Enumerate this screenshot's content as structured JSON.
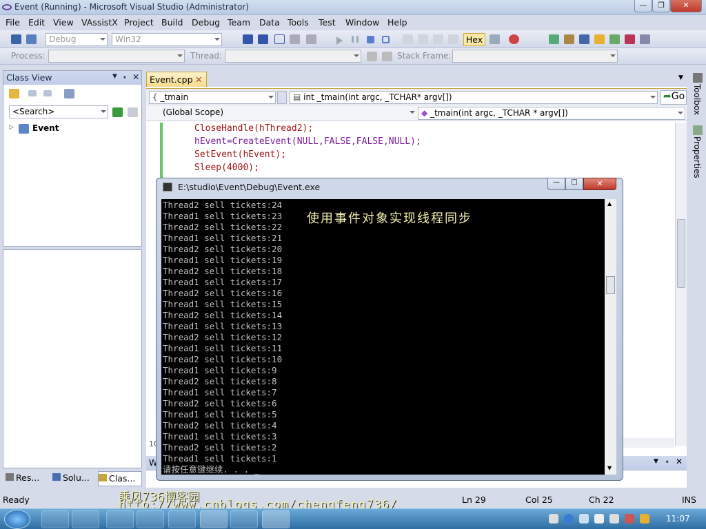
{
  "window": {
    "title": "Event (Running) - Microsoft Visual Studio (Administrator)"
  },
  "menu": [
    "File",
    "Edit",
    "View",
    "VAssistX",
    "Project",
    "Build",
    "Debug",
    "Team",
    "Data",
    "Tools",
    "Test",
    "Window",
    "Help"
  ],
  "toolbar": {
    "config": "Debug",
    "platform": "Win32",
    "hex_label": "Hex",
    "process_label": "Process:",
    "thread_label": "Thread:",
    "stackframe_label": "Stack Frame:"
  },
  "classview": {
    "title": "Class View",
    "search_placeholder": "<Search>",
    "tree_root": "Event"
  },
  "bottom_tabs": [
    "Res...",
    "Solu...",
    "Clas..."
  ],
  "editor": {
    "tab": "Event.cpp",
    "scope_combo": "_tmain",
    "function_combo": "int _tmain(int argc, _TCHAR* argv[])",
    "global_scope": "(Global Scope)",
    "member_combo": "_tmain(int argc, _TCHAR * argv[])",
    "go_label": "Go",
    "code": [
      "CloseHandle(hThread2);",
      "hEvent=CreateEvent(NULL,FALSE,FALSE,NULL);",
      "SetEvent(hEvent);",
      "Sleep(4000);"
    ],
    "line_fragment": "10"
  },
  "right_panel": {
    "toolbox": "Toolbox",
    "properties": "Properties"
  },
  "console": {
    "title": "E:\\studio\\Event\\Debug\\Event.exe",
    "lines": [
      "Thread2 sell tickets:24",
      "Thread1 sell tickets:23",
      "Thread2 sell tickets:22",
      "Thread1 sell tickets:21",
      "Thread2 sell tickets:20",
      "Thread1 sell tickets:19",
      "Thread2 sell tickets:18",
      "Thread1 sell tickets:17",
      "Thread2 sell tickets:16",
      "Thread1 sell tickets:15",
      "Thread2 sell tickets:14",
      "Thread1 sell tickets:13",
      "Thread2 sell tickets:12",
      "Thread1 sell tickets:11",
      "Thread2 sell tickets:10",
      "Thread1 sell tickets:9",
      "Thread2 sell tickets:8",
      "Thread1 sell tickets:7",
      "Thread2 sell tickets:6",
      "Thread1 sell tickets:5",
      "Thread2 sell tickets:4",
      "Thread1 sell tickets:3",
      "Thread2 sell tickets:2",
      "Thread1 sell tickets:1",
      "请按任意键继续. . . _"
    ],
    "overlay_caption": "使用事件对象实现线程同步"
  },
  "output_window_label": "W",
  "watermark": {
    "line1": "乘风736博客园",
    "line2": "http://www.cnblogs.com/chengfeng736/"
  },
  "status": {
    "state": "Ready",
    "ln": "Ln 29",
    "col": "Col 25",
    "ch": "Ch 22",
    "mode": "INS"
  },
  "taskbar": {
    "time": "11:07"
  }
}
